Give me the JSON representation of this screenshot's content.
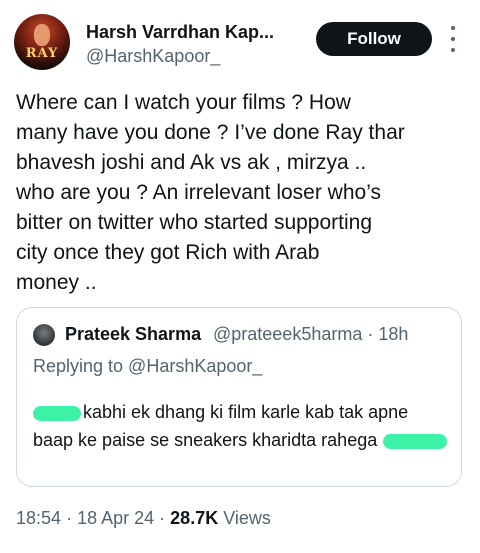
{
  "author": {
    "name": "Harsh Varrdhan Kap...",
    "handle": "@HarshKapoor_",
    "avatar_text": "RAY"
  },
  "follow_label": "Follow",
  "tweet": {
    "text": "Where can I watch your films ? How\nmany have you done ? I’ve done Ray thar\nbhavesh joshi and Ak vs ak , mirzya ..\nwho are you ? An irrelevant loser who’s\nbitter on twitter who started supporting\ncity once they got Rich with Arab\nmoney .."
  },
  "quoted": {
    "name": "Prateek Sharma",
    "handle": "@prateeek5harma",
    "separator": "·",
    "time": "18h",
    "reply_to": "Replying to @HarshKapoor_",
    "text_part1": "kabhi ek dhang ki film karle kab tak apne baap ke paise se sneakers kharidta rahega"
  },
  "meta": {
    "time": "18:54",
    "date": "18 Apr 24",
    "separator": "·",
    "views_count": "28.7K",
    "views_label": "Views"
  },
  "colors": {
    "text": "#0f1419",
    "secondary": "#536471",
    "border": "#cfd9de",
    "redaction": "#3bf2a6"
  }
}
